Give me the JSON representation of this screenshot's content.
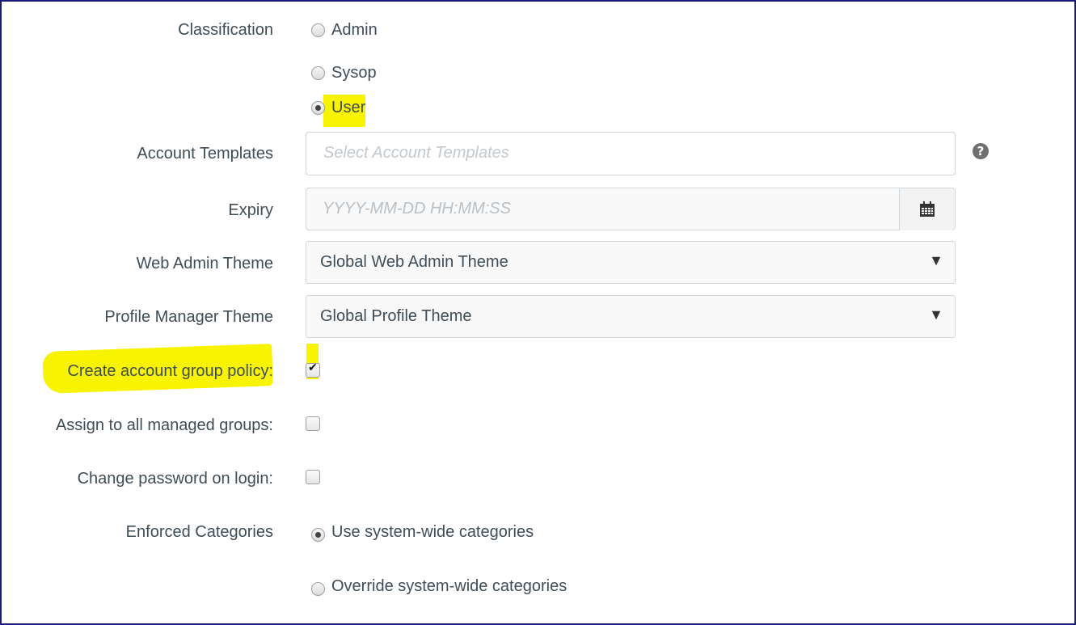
{
  "form": {
    "classification": {
      "label": "Classification",
      "options": [
        {
          "label": "Admin",
          "checked": false
        },
        {
          "label": "Sysop",
          "checked": false
        },
        {
          "label": "User",
          "checked": true
        }
      ]
    },
    "account_templates": {
      "label": "Account Templates",
      "placeholder": "Select Account Templates",
      "help_icon": "question-circle-icon",
      "help_glyph": "?"
    },
    "expiry": {
      "label": "Expiry",
      "placeholder": "YYYY-MM-DD HH:MM:SS",
      "icon": "calendar-icon"
    },
    "web_admin_theme": {
      "label": "Web Admin Theme",
      "value": "Global Web Admin Theme",
      "arrow": "▼"
    },
    "profile_manager_theme": {
      "label": "Profile Manager Theme",
      "value": "Global Profile Theme",
      "arrow": "▼"
    },
    "create_account_group_policy": {
      "label": "Create account group policy:",
      "checked": true
    },
    "assign_to_all_managed_groups": {
      "label": "Assign to all managed groups:",
      "checked": false
    },
    "change_password_on_login": {
      "label": "Change password on login:",
      "checked": false
    },
    "enforced_categories": {
      "label": "Enforced Categories",
      "options": [
        {
          "label": "Use system-wide categories",
          "checked": true
        },
        {
          "label": "Override system-wide categories",
          "checked": false
        }
      ]
    }
  },
  "colors": {
    "highlight": "#f8f400",
    "text": "#3f4d57",
    "border": "#cfd6db",
    "frame": "#1a1a7a"
  }
}
